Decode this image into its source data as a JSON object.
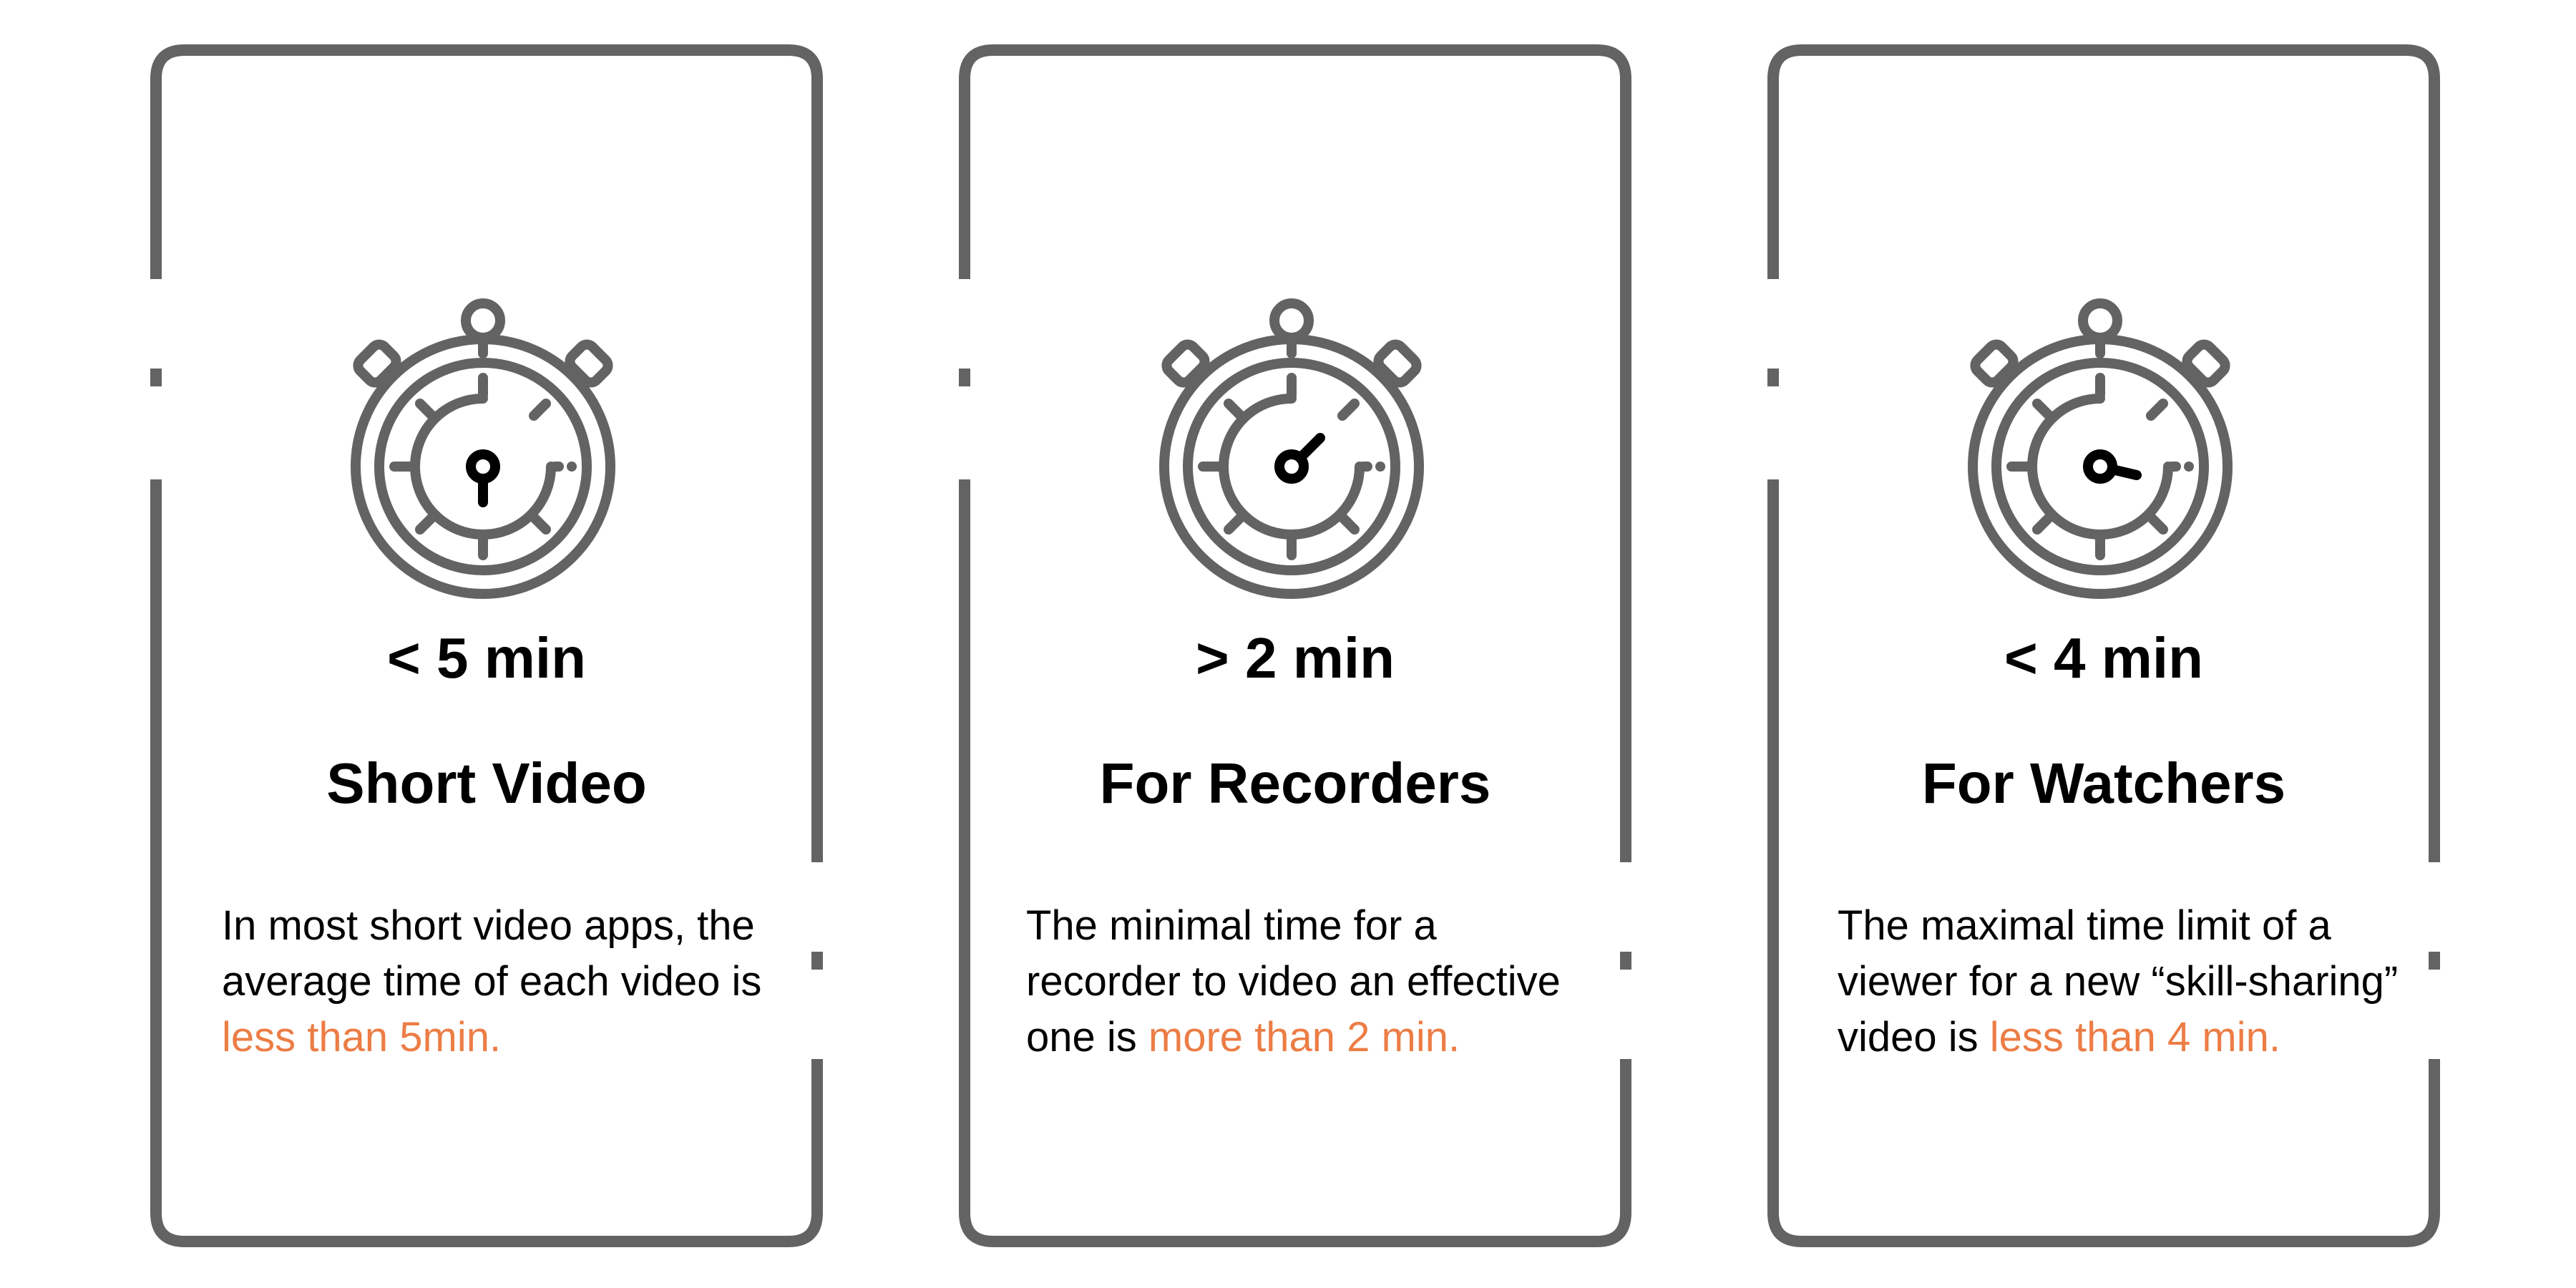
{
  "colors": {
    "outline": "#636363",
    "accent": "#ec7d45",
    "text": "#000000",
    "hand": "#000000"
  },
  "icon": "stopwatch-icon",
  "cards": [
    {
      "stat": "< 5 min",
      "title": "Short Video",
      "desc_before": "In most short video apps, the average time of each video is ",
      "desc_highlight": "less than 5min.",
      "hand_angle_deg": 180
    },
    {
      "stat": "> 2 min",
      "title": "For Recorders",
      "desc_before": "The minimal time for a recorder to video an effective one is ",
      "desc_highlight": "more than 2 min.",
      "hand_angle_deg": 45
    },
    {
      "stat": "< 4 min",
      "title": "For Watchers",
      "desc_before": "The maximal time limit of a viewer for a new “skill-sharing” video is ",
      "desc_highlight": "less than 4 min.",
      "hand_angle_deg": 103
    }
  ]
}
